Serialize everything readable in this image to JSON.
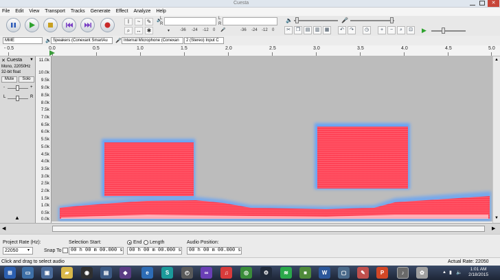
{
  "window": {
    "title": "Cuesta"
  },
  "menu": [
    "File",
    "Edit",
    "View",
    "Transport",
    "Tracks",
    "Generate",
    "Effect",
    "Analyze",
    "Help"
  ],
  "meters": {
    "play_scale": [
      "-36",
      "-24",
      "-12",
      "0"
    ],
    "record_scale": [
      "-36",
      "-24",
      "-12",
      "0"
    ],
    "left_channel": "L",
    "right_channel": "R"
  },
  "devices": {
    "host": "MME",
    "output": "Speakers (Conexant SmartAu",
    "input": "Internal Microphone (Conexan",
    "channels": "2 (Stereo) Input C"
  },
  "ruler": {
    "labels": [
      "- 0.5",
      "0.0",
      "0.5",
      "1.0",
      "1.5",
      "2.0",
      "2.5",
      "3.0",
      "3.5",
      "4.0",
      "4.5",
      "5.0"
    ]
  },
  "track": {
    "name": "Cuesta",
    "info1": "Mono, 22050Hz",
    "info2": "32-bit float",
    "mute_label": "Mute",
    "solo_label": "Solo",
    "gain_left": "-",
    "gain_right": "+",
    "pan_left": "L",
    "pan_right": "R"
  },
  "freq_scale": [
    "11.0k",
    "10.0k",
    "9.5k",
    "9.0k",
    "8.5k",
    "8.0k",
    "7.5k",
    "7.0k",
    "6.5k",
    "6.0k",
    "5.5k",
    "5.0k",
    "4.5k",
    "4.0k",
    "3.5k",
    "3.0k",
    "2.5k",
    "2.0k",
    "1.5k",
    "1.0k",
    "0.5k",
    "0.0k"
  ],
  "bottom": {
    "project_rate_label": "Project Rate (Hz):",
    "project_rate": "22050",
    "snap_label": "Snap To",
    "selection_start_label": "Selection Start:",
    "selection_start": "00 h 00 m 00.000 s",
    "end_label": "End",
    "length_label": "Length",
    "end_value": "00 h 00 m 00.000 s",
    "audio_position_label": "Audio Position:",
    "audio_position": "00 h 00 m 00.000 s"
  },
  "status": {
    "message": "Click and drag to select audio",
    "rate": "Actual Rate: 22050"
  },
  "clock": {
    "time": "1:01 AM",
    "date": "2/18/2015"
  },
  "colors": {
    "accent": "#3b76c4",
    "spectrogram_hot": "#ff3048",
    "spectrogram_cool": "#4aa0ff"
  }
}
